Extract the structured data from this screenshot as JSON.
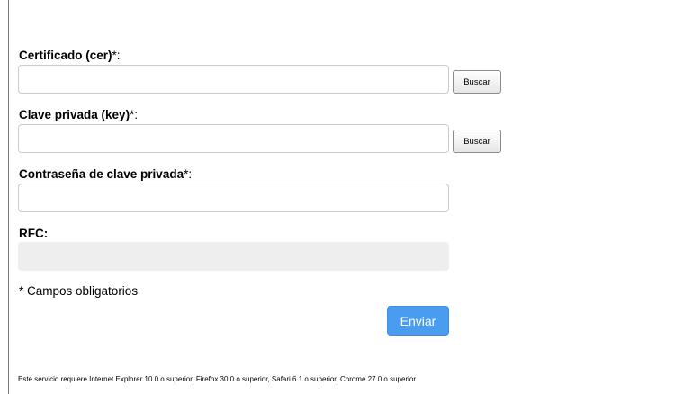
{
  "form": {
    "certificate": {
      "label": "Certificado (cer)",
      "required_mark": "*:",
      "value": "",
      "browse_label": "Buscar"
    },
    "private_key": {
      "label": "Clave privada (key)",
      "required_mark": "*:",
      "value": "",
      "browse_label": "Buscar"
    },
    "password": {
      "label": "Contraseña de clave privada",
      "required_mark": "*:",
      "value": ""
    },
    "rfc": {
      "label": "RFC:",
      "value": ""
    },
    "required_note": "* Campos obligatorios",
    "submit_label": "Enviar"
  },
  "footer": {
    "browser_note": "Este servicio requiere Internet Explorer 10.0 o superior, Firefox 30.0 o superior, Safari 6.1 o superior, Chrome 27.0 o superior."
  },
  "colors": {
    "submit_button": "#4a9cf0",
    "readonly_field": "#eeeeee",
    "input_border": "#cccccc"
  }
}
